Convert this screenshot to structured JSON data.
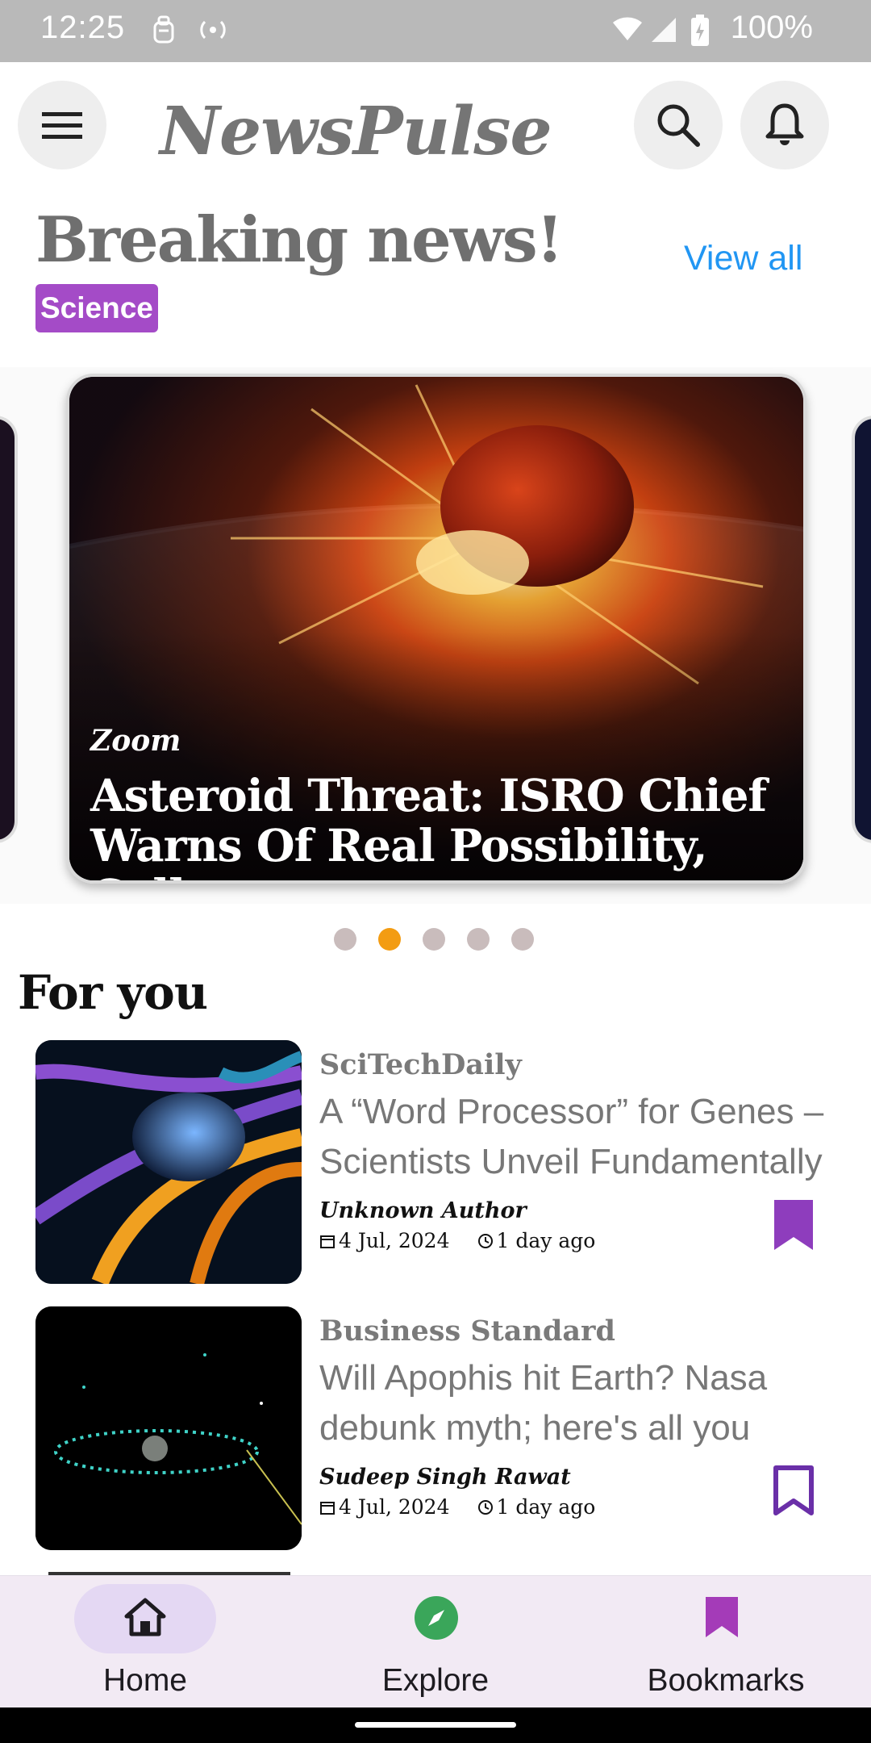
{
  "status_bar": {
    "time": "12:25",
    "battery": "100%"
  },
  "app": {
    "name": "NewsPulse"
  },
  "breaking": {
    "title": "Breaking news!",
    "view_all": "View all",
    "category": "Science"
  },
  "carousel": {
    "active_index": 1,
    "dot_count": 5,
    "featured": {
      "source": "Zoom",
      "headline_line1": "Asteroid Threat: ISRO Chief",
      "headline_line2": "Warns Of Real Possibility, Calls"
    }
  },
  "for_you": {
    "title": "For you",
    "items": [
      {
        "publisher": "SciTechDaily",
        "title_line1": "A “Word Processor” for Genes –",
        "title_line2": "Scientists Unveil Fundamentally",
        "author": "Unknown Author",
        "date": "4 Jul, 2024",
        "ago": "1 day ago",
        "bookmarked": true
      },
      {
        "publisher": "Business Standard",
        "title_line1": "Will Apophis hit Earth? Nasa",
        "title_line2": "debunk myth; here's all you",
        "author": "Sudeep Singh Rawat",
        "date": "4 Jul, 2024",
        "ago": "1 day ago",
        "bookmarked": false
      }
    ]
  },
  "bottom_nav": {
    "home": "Home",
    "explore": "Explore",
    "bookmarks": "Bookmarks",
    "active": "home"
  },
  "colors": {
    "accent_blue": "#2196f3",
    "chip_purple": "#a44bc7",
    "bookmark_purple": "#8e3dbd",
    "explore_green": "#3aa65a",
    "dot_active": "#f39c12"
  }
}
